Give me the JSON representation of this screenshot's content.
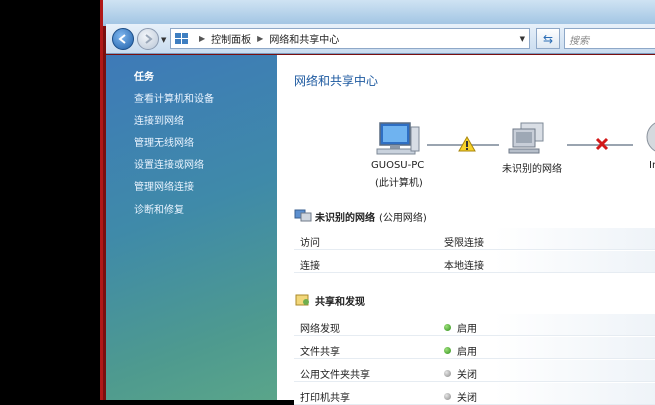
{
  "nav": {
    "breadcrumb": [
      "控制面板",
      "网络和共享中心"
    ],
    "search_placeholder": "搜索"
  },
  "sidebar": {
    "heading": "任务",
    "items": [
      {
        "label": "查看计算机和设备"
      },
      {
        "label": "连接到网络"
      },
      {
        "label": "管理无线网络"
      },
      {
        "label": "设置连接或网络"
      },
      {
        "label": "管理网络连接"
      },
      {
        "label": "诊断和修复"
      }
    ]
  },
  "main": {
    "title": "网络和共享中心",
    "netmap": {
      "computer_name": "GUOSU-PC",
      "computer_sub": "(此计算机)",
      "network_label": "未识别的网络",
      "internet_label_partial": "In"
    },
    "network": {
      "name": "未识别的网络",
      "type": "(公用网络)",
      "rows": [
        {
          "key": "访问",
          "value": "受限连接"
        },
        {
          "key": "连接",
          "value": "本地连接"
        }
      ]
    },
    "sharing": {
      "heading": "共享和发现",
      "rows": [
        {
          "key": "网络发现",
          "value": "启用",
          "status": "on"
        },
        {
          "key": "文件共享",
          "value": "启用",
          "status": "on"
        },
        {
          "key": "公用文件夹共享",
          "value": "关闭",
          "status": "off"
        },
        {
          "key": "打印机共享",
          "value": "关闭",
          "status": "off"
        }
      ]
    }
  }
}
